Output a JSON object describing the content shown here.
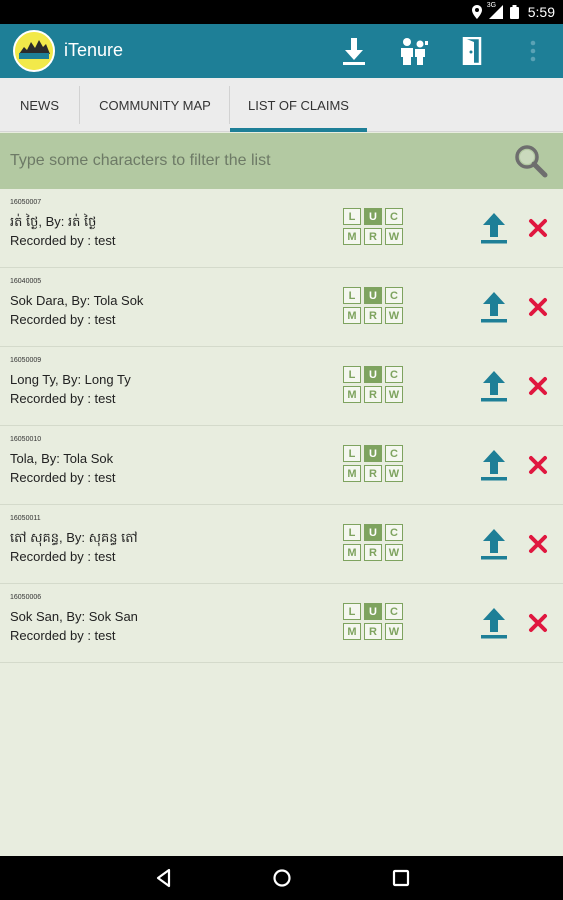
{
  "status_bar": {
    "time": "5:59",
    "network": "3G"
  },
  "app_bar": {
    "title": "iTenure",
    "logo_text": "iTenure",
    "actions": [
      "download-icon",
      "users-icon",
      "exit-icon",
      "more-vert-icon"
    ]
  },
  "tabs": [
    {
      "label": "NEWS",
      "active": false
    },
    {
      "label": "COMMUNITY MAP",
      "active": false
    },
    {
      "label": "LIST OF CLAIMS",
      "active": true
    }
  ],
  "filter": {
    "placeholder": "Type some characters to filter the list",
    "value": ""
  },
  "status_letters": [
    "L",
    "U",
    "C",
    "M",
    "R",
    "W"
  ],
  "claims": [
    {
      "id": "16050007",
      "title": "រត់ ថ្ងៃ, By: រត់ ថ្ងៃ",
      "recorded": "Recorded by : test",
      "active_status": "U"
    },
    {
      "id": "16040005",
      "title": "Sok Dara, By: Tola Sok",
      "recorded": "Recorded by : test",
      "active_status": "U"
    },
    {
      "id": "16050009",
      "title": "Long Ty, By: Long  Ty",
      "recorded": "Recorded by : test",
      "active_status": "U"
    },
    {
      "id": "16050010",
      "title": "Tola, By: Tola Sok",
      "recorded": "Recorded by : test",
      "active_status": "U"
    },
    {
      "id": "16050011",
      "title": "តៅ សុគន្ធ, By: សុគន្ធ តៅ",
      "recorded": "Recorded by : test",
      "active_status": "U"
    },
    {
      "id": "16050006",
      "title": "Sok San, By: Sok San",
      "recorded": "Recorded by : test",
      "active_status": "U"
    }
  ],
  "colors": {
    "primary": "#1e7f97",
    "filter_bg": "#b3c9a2",
    "status_green": "#7ea35f",
    "delete_red": "#e0173f",
    "list_bg": "#e8eddf"
  }
}
